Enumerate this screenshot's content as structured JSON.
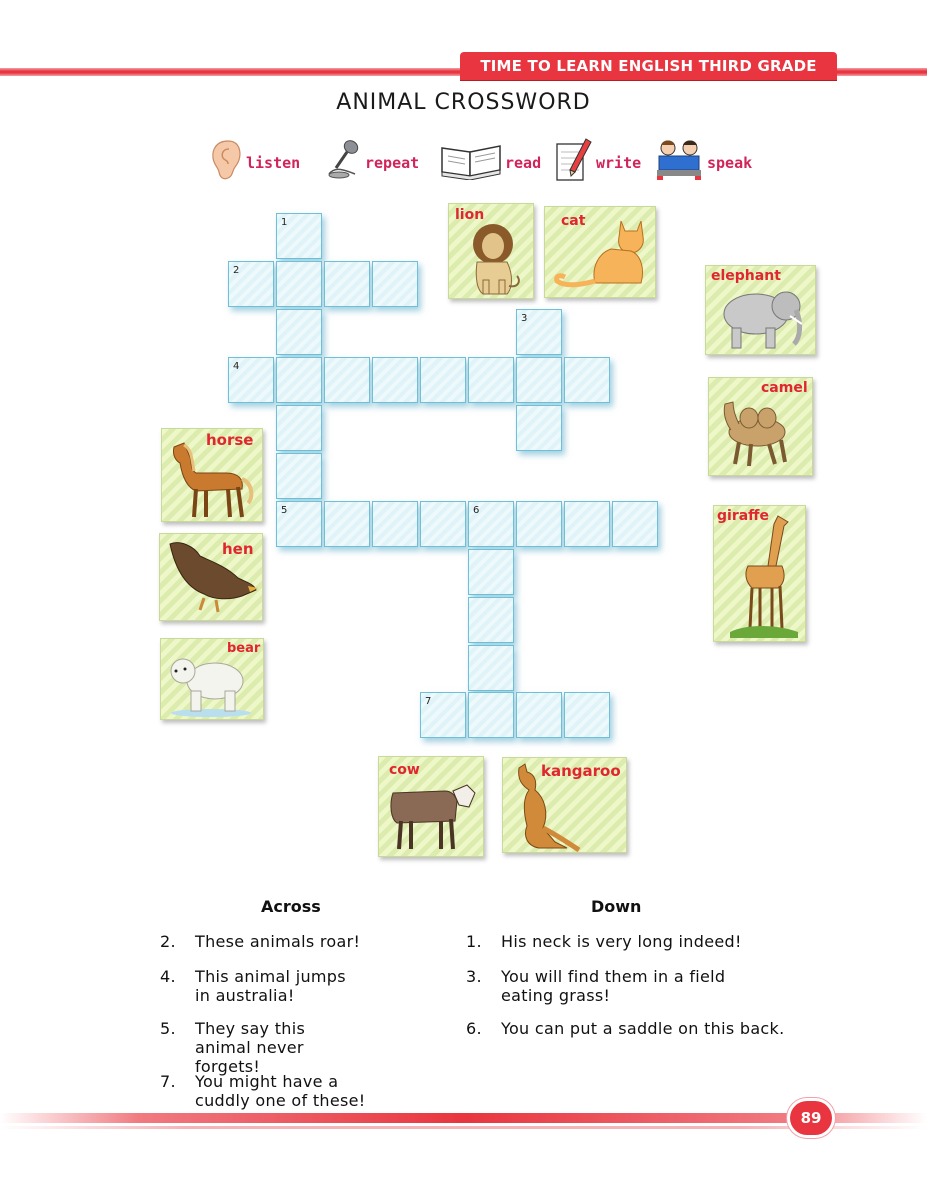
{
  "header": {
    "series_title": "TIME TO LEARN ENGLISH THIRD GRADE"
  },
  "page_title": "ANIMAL CROSSWORD",
  "instructions": [
    "listen",
    "repeat",
    "read",
    "write",
    "speak"
  ],
  "crossword": {
    "numbers": [
      "1",
      "2",
      "3",
      "4",
      "5",
      "6",
      "7"
    ]
  },
  "animals": {
    "lion": "lion",
    "cat": "cat",
    "elephant": "elephant",
    "camel": "camel",
    "horse": "horse",
    "giraffe": "giraffe",
    "hen": "hen",
    "bear": "bear",
    "cow": "cow",
    "kangaroo": "kangaroo"
  },
  "clues": {
    "across_heading": "Across",
    "down_heading": "Down",
    "across": [
      {
        "num": "2.",
        "text": "These animals roar!"
      },
      {
        "num": "4.",
        "text": "This animal jumps in australia!"
      },
      {
        "num": "5.",
        "text": "They say this animal never forgets!"
      },
      {
        "num": "7.",
        "text": "You might have a cuddly one of these!"
      }
    ],
    "down": [
      {
        "num": "1.",
        "text": "His neck is very long indeed!"
      },
      {
        "num": "3.",
        "text": "You will find them in a field eating grass!"
      },
      {
        "num": "6.",
        "text": "You can put a saddle on this back."
      }
    ]
  },
  "footer": {
    "page_number": "89"
  },
  "colors": {
    "accent_red": "#e8353f",
    "label_pink": "#d0245a",
    "grid_blue": "#6fbfd6",
    "card_green": "#dcebae"
  }
}
